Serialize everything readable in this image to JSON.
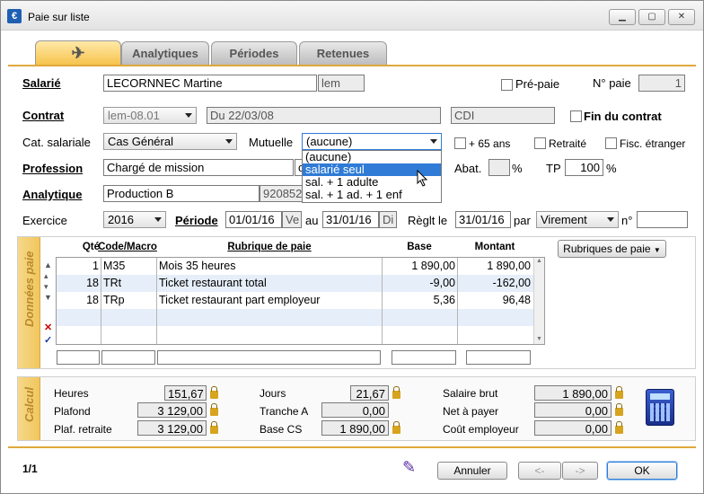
{
  "window": {
    "title": "Paie sur liste",
    "minimize_label": "▁",
    "maximize_label": "▢",
    "close_label": "✕"
  },
  "tabs": [
    {
      "label": ""
    },
    {
      "label": "Analytiques"
    },
    {
      "label": "Périodes"
    },
    {
      "label": "Retenues"
    }
  ],
  "salarie": {
    "label": "Salarié",
    "name": "LECORNNEC Martine",
    "code": "lem",
    "prepaie_label": "Pré-paie",
    "npaie_label": "N° paie",
    "npaie_value": "1"
  },
  "contrat": {
    "label": "Contrat",
    "value": "lem-08.01",
    "date": "Du 22/03/08",
    "type": "CDI",
    "fin_label": "Fin du contrat"
  },
  "cat": {
    "label": "Cat. salariale",
    "value": "Cas Général"
  },
  "mutuelle": {
    "label": "Mutuelle",
    "value": "(aucune)",
    "options": [
      "(aucune)",
      "salarié seul",
      "sal. + 1 adulte",
      "sal. + 1 ad. + 1 enf"
    ]
  },
  "checks": {
    "plus65": "+ 65 ans",
    "retraite": "Retraité",
    "fisc": "Fisc. étranger"
  },
  "profession": {
    "label": "Profession",
    "value": "Chargé de mission",
    "extra": "c"
  },
  "abat": {
    "label": "Abat.",
    "value": "",
    "unit": "%",
    "tp_label": "TP",
    "tp_value": "100",
    "tp_unit": "%"
  },
  "analytique": {
    "label": "Analytique",
    "value": "Production B",
    "code": "920852"
  },
  "exercice": {
    "label": "Exercice",
    "value": "2016"
  },
  "periode": {
    "label": "Période",
    "from": "01/01/16",
    "from_day": "Ve",
    "au": "au",
    "to": "31/01/16",
    "to_day": "Di",
    "reglt_label": "Règlt le",
    "reglt": "31/01/16",
    "par": "par",
    "mode": "Virement",
    "no": "n°",
    "no_value": ""
  },
  "donnees": {
    "side_label": "Données paie",
    "headers": [
      "Qté",
      "Code/Macro",
      "Rubrique de paie",
      "Base",
      "Montant"
    ],
    "rows": [
      [
        "1",
        "M35",
        "Mois 35 heures",
        "1 890,00",
        "1 890,00"
      ],
      [
        "18",
        "TRt",
        "Ticket restaurant total",
        "-9,00",
        "-162,00"
      ],
      [
        "18",
        "TRp",
        "Ticket restaurant part employeur",
        "5,36",
        "96,48"
      ]
    ],
    "rubriques_btn": "Rubriques de paie"
  },
  "calcul": {
    "side_label": "Calcul",
    "heures": {
      "label": "Heures",
      "value": "151,67"
    },
    "plafond": {
      "label": "Plafond",
      "value": "3 129,00"
    },
    "plaf_retraite": {
      "label": "Plaf. retraite",
      "value": "3 129,00"
    },
    "jours": {
      "label": "Jours",
      "value": "21,67"
    },
    "tranche_a": {
      "label": "Tranche A",
      "value": "0,00"
    },
    "base_cs": {
      "label": "Base CS",
      "value": "1 890,00"
    },
    "salaire_brut": {
      "label": "Salaire brut",
      "value": "1 890,00"
    },
    "net_payer": {
      "label": "Net à payer",
      "value": "0,00"
    },
    "cout": {
      "label": "Coût employeur",
      "value": "0,00"
    }
  },
  "footer": {
    "page": "1/1",
    "annuler": "Annuler",
    "prev": "<-",
    "next": "->",
    "ok": "OK"
  }
}
